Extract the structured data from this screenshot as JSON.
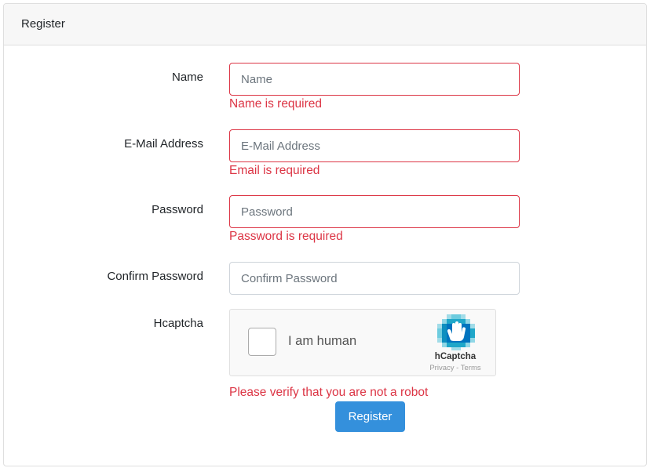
{
  "card": {
    "header": "Register"
  },
  "form": {
    "name": {
      "label": "Name",
      "placeholder": "Name",
      "value": "",
      "error": "Name is required"
    },
    "email": {
      "label": "E-Mail Address",
      "placeholder": "E-Mail Address",
      "value": "",
      "error": "Email is required"
    },
    "password": {
      "label": "Password",
      "placeholder": "Password",
      "value": "",
      "error": "Password is required"
    },
    "confirm_password": {
      "label": "Confirm Password",
      "placeholder": "Confirm Password",
      "value": ""
    },
    "captcha": {
      "label": "Hcaptcha",
      "checkbox_text": "I am human",
      "brand": "hCaptcha",
      "privacy_link": "Privacy",
      "separator": " - ",
      "terms_link": "Terms",
      "logo_icon": "hcaptcha-logo-icon",
      "error": "Please verify that you are not a robot"
    },
    "submit_label": "Register"
  },
  "colors": {
    "error": "#dc3545",
    "primary": "#3490dc",
    "header_bg": "#f7f7f7",
    "captcha_logo": "#0074bf"
  }
}
